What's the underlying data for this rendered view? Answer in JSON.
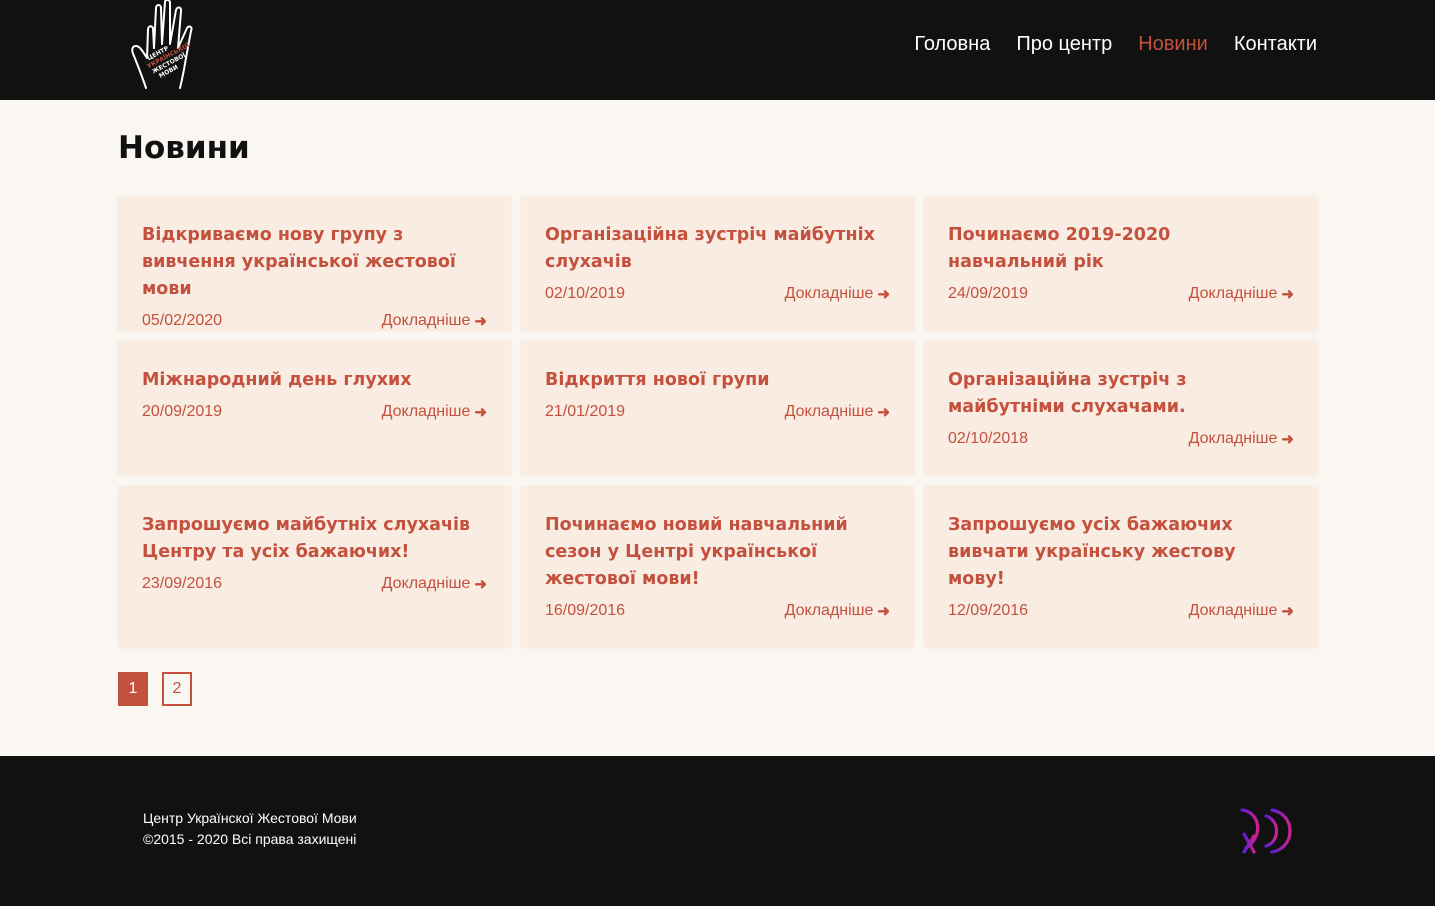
{
  "header": {
    "logo_icon": "hand-logo-icon",
    "logo_text": [
      "ЦЕНТР",
      "УКРАЇНСЬКОЇ",
      "ЖЕСТОВОЇ",
      "МОВИ"
    ],
    "nav": [
      {
        "label": "Головна",
        "active": false
      },
      {
        "label": "Про центр",
        "active": false
      },
      {
        "label": "Новини",
        "active": true
      },
      {
        "label": "Контакти",
        "active": false
      }
    ]
  },
  "main": {
    "title": "Новини",
    "more_label": "Докладніше",
    "arrow_icon": "arrow-right-icon",
    "cards": [
      {
        "title": "Відкриваємо нову групу з вивчення української жестової мови",
        "date": "05/02/2020"
      },
      {
        "title": "Організаційна зустріч майбутніх слухачів",
        "date": "02/10/2019"
      },
      {
        "title": "Починаємо 2019-2020 навчальний рік",
        "date": "24/09/2019"
      },
      {
        "title": "Міжнародний день глухих",
        "date": "20/09/2019"
      },
      {
        "title": "Відкриття нової групи",
        "date": "21/01/2019"
      },
      {
        "title": "Організаційна зустріч з майбутніми слухачами.",
        "date": "02/10/2018"
      },
      {
        "title": "Запрошуємо майбутніх слухачів Центру та усіх бажаючих!",
        "date": "23/09/2016"
      },
      {
        "title": "Починаємо новий навчальний сезон у Центрі української жестової мови!",
        "date": "16/09/2016"
      },
      {
        "title": "Запрошуємо усіх бажаючих вивчати українську жестову мову!",
        "date": "12/09/2016"
      }
    ],
    "pagination": [
      {
        "label": "1",
        "current": true
      },
      {
        "label": "2",
        "current": false
      }
    ]
  },
  "footer": {
    "line1": "Центр Українскої Жестової Мови",
    "line2": "©2015 - 2020 Всі права захищені",
    "logo_icon": "dev-logo-icon"
  },
  "colors": {
    "accent": "#c4513d",
    "header_bg": "#111111",
    "page_bg": "#faf7f2",
    "card_bg": "#f9ece2"
  }
}
